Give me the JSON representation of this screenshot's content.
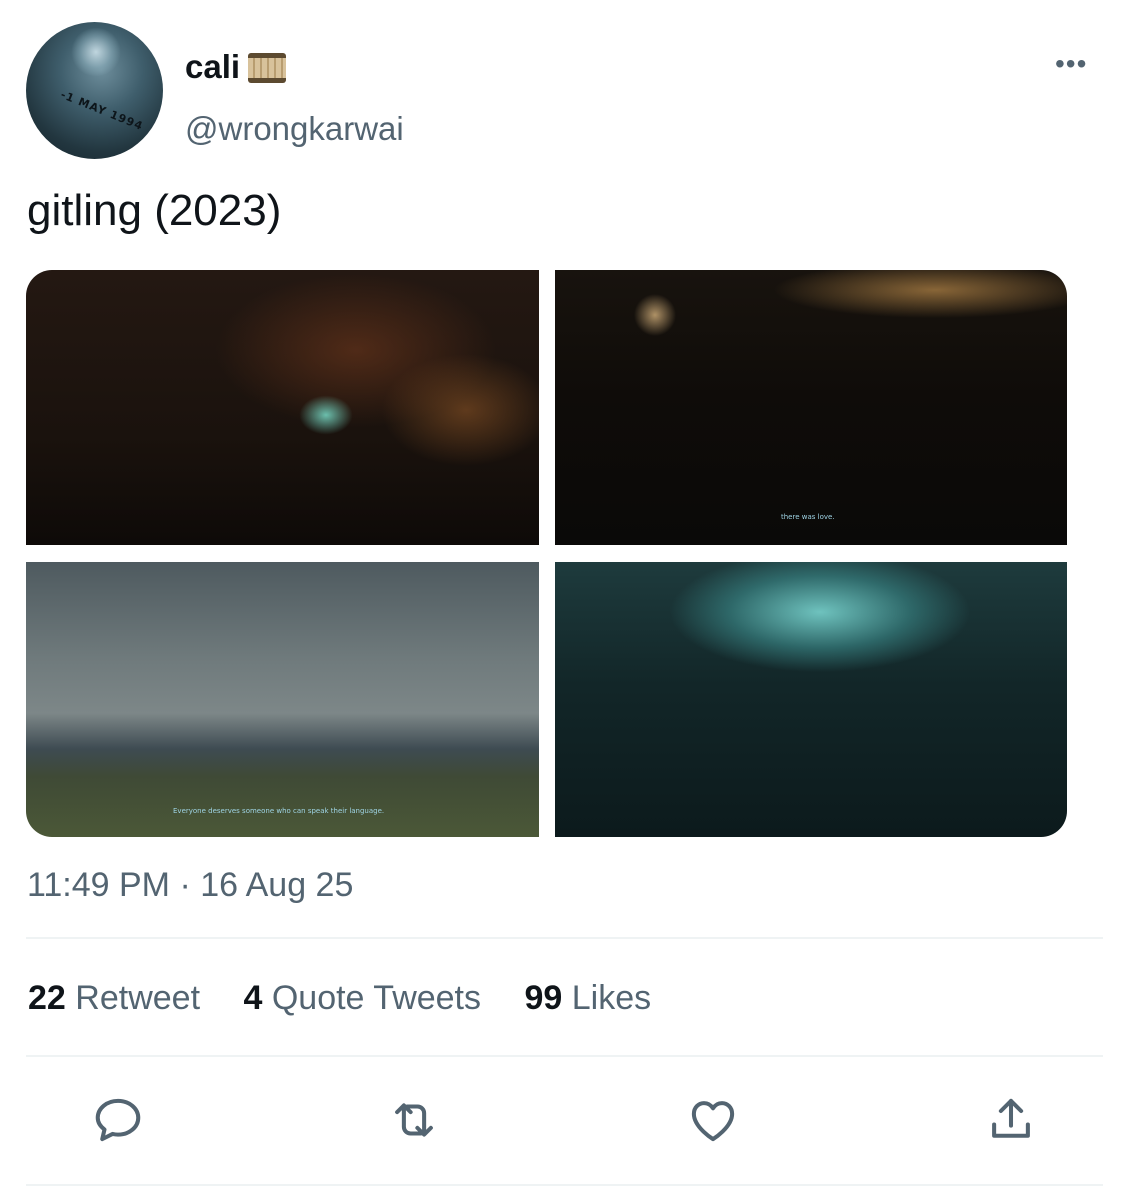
{
  "author": {
    "display_name": "cali",
    "handle": "@wrongkarwai",
    "avatar_text": "-1 MAY 1994"
  },
  "tweet": {
    "text": "gitling (2023)",
    "media": [
      {
        "subtitle": ""
      },
      {
        "subtitle": "there was love."
      },
      {
        "subtitle": "Everyone deserves someone who can speak their language."
      },
      {
        "subtitle": ""
      }
    ],
    "timestamp": "11:49 PM · 16 Aug 25"
  },
  "stats": {
    "retweets": "22",
    "retweets_label": "Retweet",
    "quotes": "4",
    "quotes_label": "Quote Tweets",
    "likes": "99",
    "likes_label": "Likes"
  },
  "icons": [
    "more-icon",
    "film-emoji-icon",
    "reply-icon",
    "retweet-icon",
    "like-icon",
    "share-icon"
  ],
  "colors": {
    "secondary_text": "#536471",
    "primary_text": "#0f1419",
    "divider": "#eff3f4"
  }
}
